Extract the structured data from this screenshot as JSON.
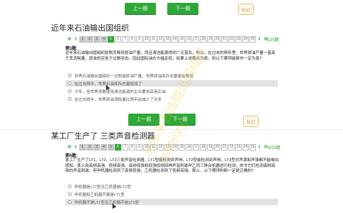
{
  "nav_top": {
    "prev_label": "上一题",
    "next_label": "下一题",
    "mark_label": "标记"
  },
  "section1": {
    "title": "近年来石油输出国组织",
    "pages": [
      "1",
      "2",
      "3",
      "4",
      "5",
      "6",
      "7",
      "8",
      "9",
      "10",
      "11",
      "12",
      "13",
      "14",
      "15",
      "16",
      "17",
      "18",
      "19",
      "20",
      "21",
      "22",
      "23",
      "24",
      "25"
    ],
    "current_page": "5",
    "counter": "5/25题",
    "question_number": "第5题:",
    "question_text": "近年来石油输出国组织欧佩克降低原油产量，而且清洁能源得到广泛普及，所以，在过去的两年里，世界原油产量一直高于其消耗量，原油供应处于过剩状态。因此国际油价大幅走低。如果上述观点为真，则以下哪项能够作一定为真?",
    "options": [
      "世界石油输出国组织一旦削减原油产量，世界原油库存总量便会降低",
      "在过去两年，世界石油库存总量增加了",
      "今年，全世界多数使用清洁能源的企业要求采用石油",
      "在过去两年，世界原油消耗量比两年前减少了许多"
    ],
    "selected_option": 1
  },
  "nav_mid": {
    "prev_label": "上一题",
    "next_label": "下一题",
    "mark_label": "标记"
  },
  "section2": {
    "title": "某工厂生产了 三类声音检测器",
    "pages": [
      "1",
      "2",
      "3",
      "4",
      "5",
      "6",
      "7",
      "8",
      "9",
      "10",
      "11",
      "12",
      "13",
      "14",
      "15",
      "16",
      "17",
      "18",
      "19",
      "20",
      "21",
      "22",
      "23",
      "24",
      "25"
    ],
    "current_page": "6",
    "counter": "6/25题",
    "question_number": "第6题:",
    "question_text": "某工厂生产了LT1、LT2、LT3三类声音检测器，LT1型能检测到声响，LT2型能检测到声响，LT3型对声源和声强都不能做出感知。某人用高频高强、低频高强、高频低强和低强低频四种声音刺激甲乙丙三种台机器进行检测，命令它们检测高频高强的声音刺激，但甲机器检测到了高频低强，乙机器检测到了低频高强。那么，以下哪项判断一定是正确的?",
    "options": [
      "甲机器是LT1型且乙机器是LT2型",
      "甲机器和乙机器不都是LT1型",
      "甲机器不是LT1型且乙机器不是LT1型"
    ],
    "selected_option": 2
  },
  "watermark": {
    "lines": [
      "近年来石油输出国组织",
      "wanjiyy"
    ]
  }
}
